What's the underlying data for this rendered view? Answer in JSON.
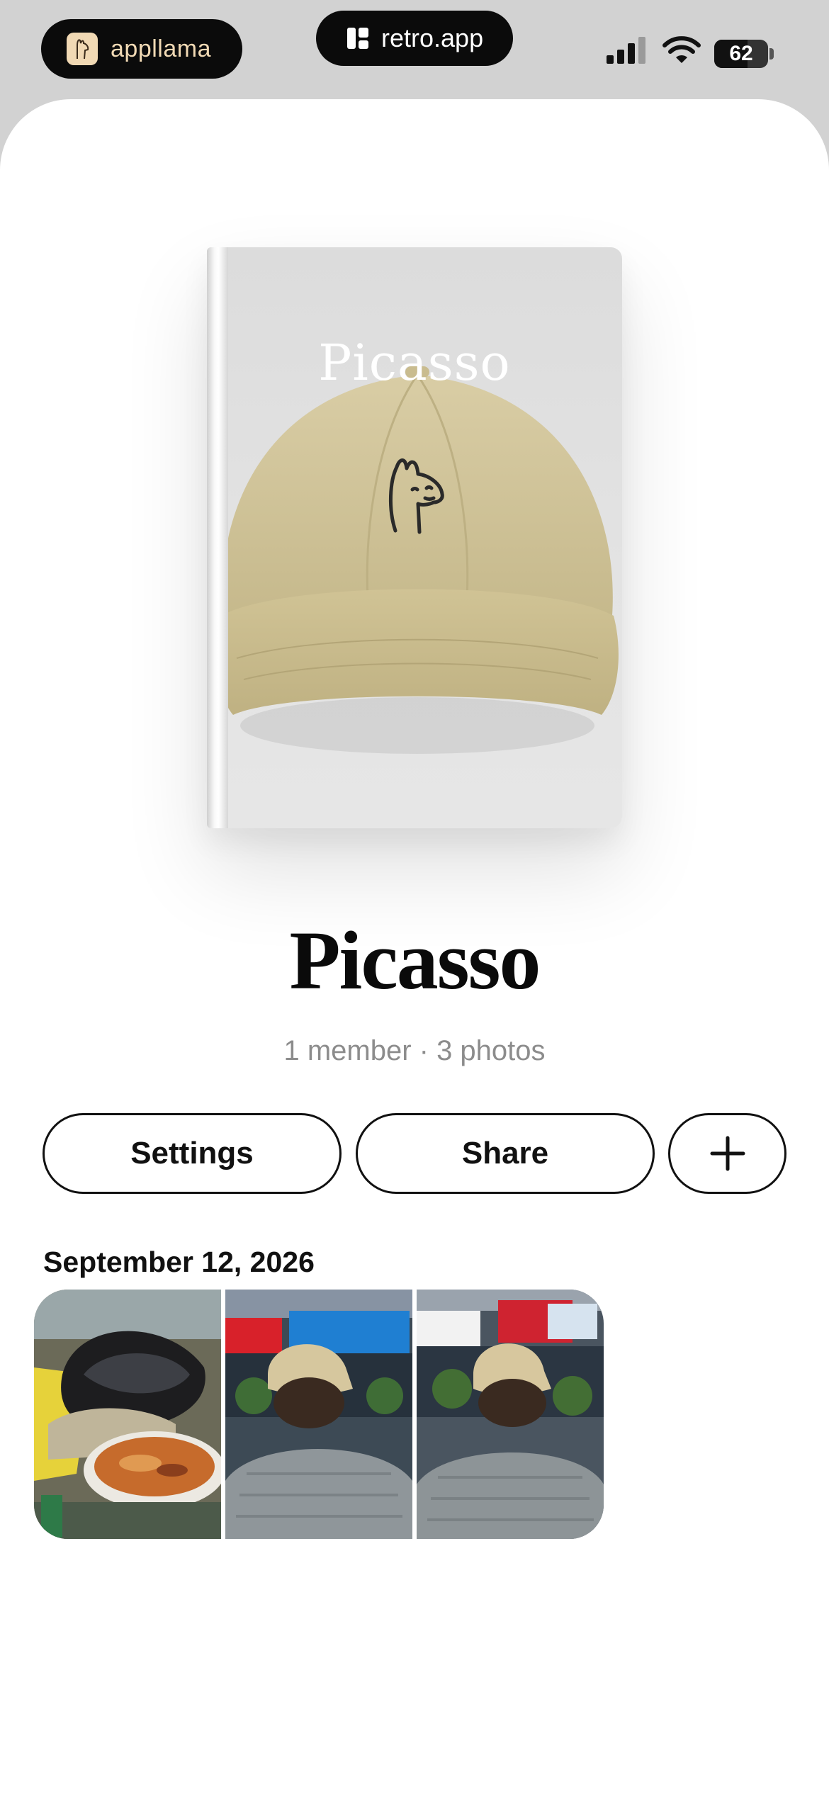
{
  "status_bar": {
    "left_pill": {
      "label": "appllama",
      "icon": "llama-logo-icon"
    },
    "center_pill": {
      "label": "retro.app",
      "icon": "retro-logo-icon"
    },
    "battery_level": "62"
  },
  "cover": {
    "title": "Picasso",
    "icon": "llama-face-icon"
  },
  "album": {
    "title": "Picasso",
    "meta": "1 member · 3 photos"
  },
  "actions": {
    "settings_label": "Settings",
    "share_label": "Share",
    "add_icon": "plus-icon"
  },
  "photos_section": {
    "date": "September 12, 2026",
    "photos": [
      {
        "description_icon": "photo-thumbnail"
      },
      {
        "description_icon": "photo-thumbnail"
      },
      {
        "description_icon": "photo-thumbnail"
      }
    ]
  },
  "colors": {
    "accent": "#111111",
    "cap": "#d2c59b",
    "meta_text": "#8c8c8c"
  }
}
